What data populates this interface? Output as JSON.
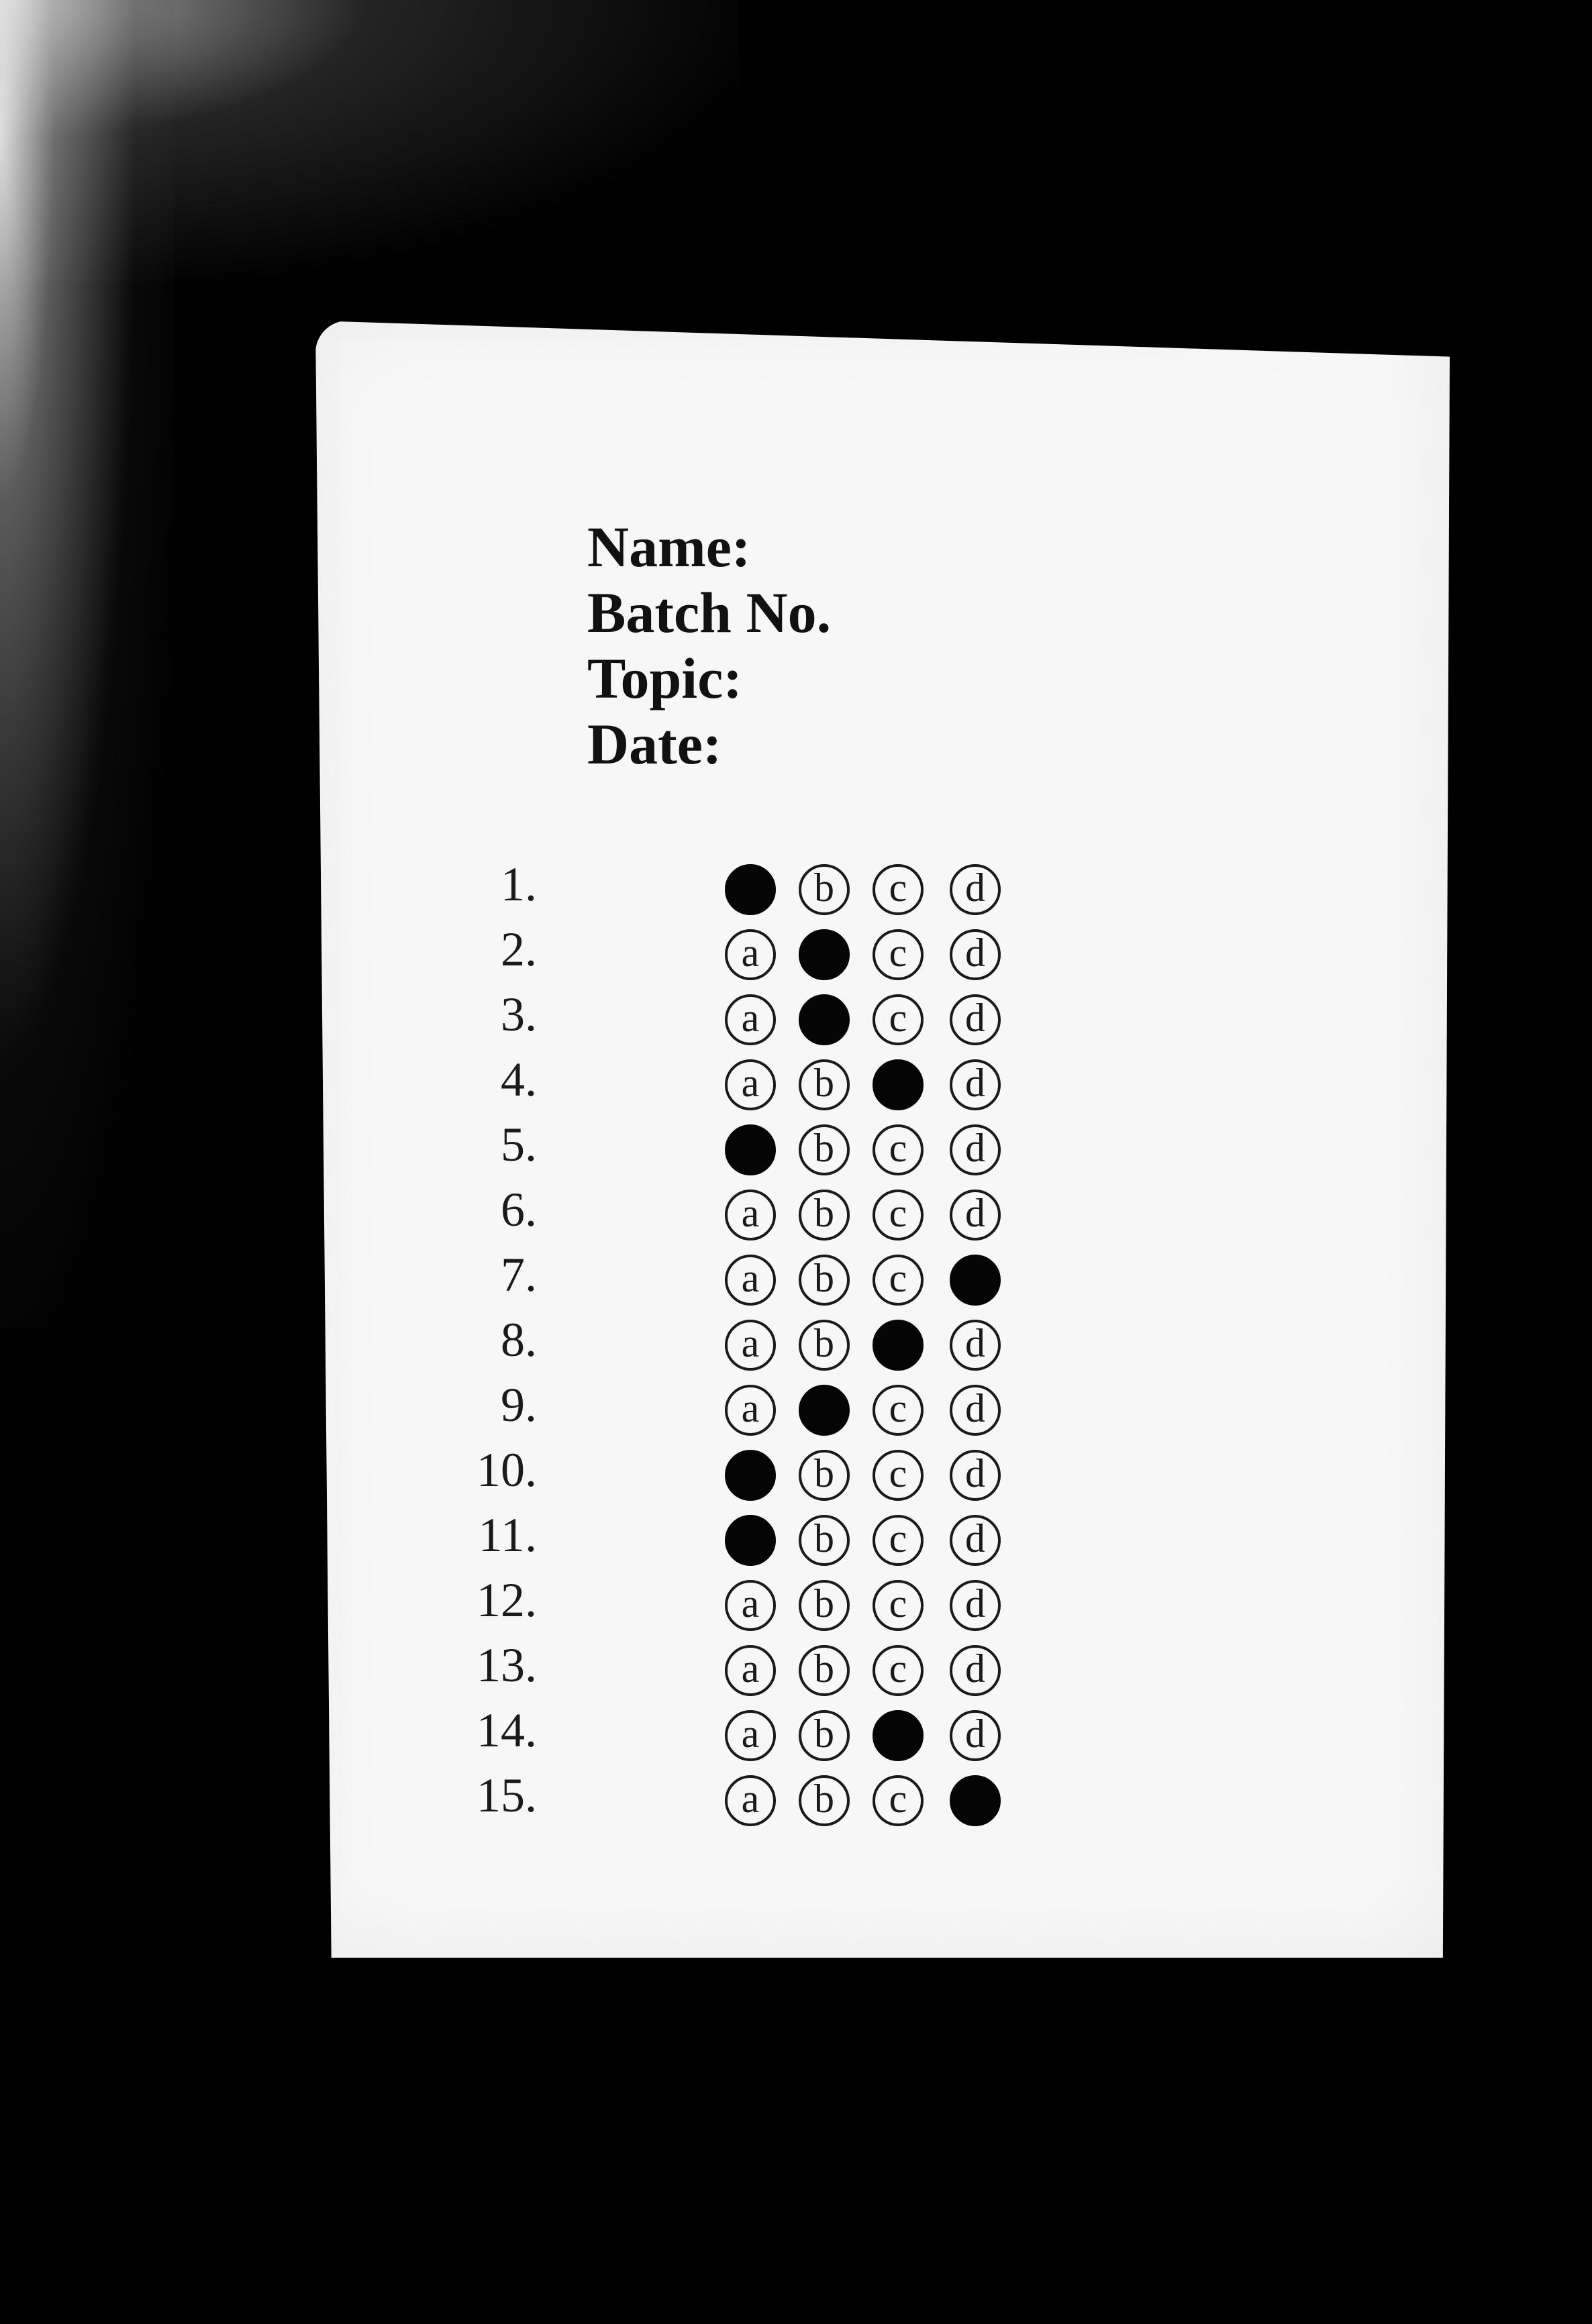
{
  "form": {
    "fields": {
      "name_label": "Name:",
      "batch_label": "Batch No.",
      "topic_label": "Topic:",
      "date_label": "Date:"
    },
    "option_letters": [
      "a",
      "b",
      "c",
      "d"
    ],
    "questions": [
      {
        "number": "1.",
        "selected": "a"
      },
      {
        "number": "2.",
        "selected": "b"
      },
      {
        "number": "3.",
        "selected": "b"
      },
      {
        "number": "4.",
        "selected": "c"
      },
      {
        "number": "5.",
        "selected": "a"
      },
      {
        "number": "6.",
        "selected": null
      },
      {
        "number": "7.",
        "selected": "d"
      },
      {
        "number": "8.",
        "selected": "c"
      },
      {
        "number": "9.",
        "selected": "b"
      },
      {
        "number": "10.",
        "selected": "a"
      },
      {
        "number": "11.",
        "selected": "a"
      },
      {
        "number": "12.",
        "selected": null
      },
      {
        "number": "13.",
        "selected": null
      },
      {
        "number": "14.",
        "selected": "c"
      },
      {
        "number": "15.",
        "selected": "d"
      }
    ]
  },
  "colors": {
    "background": "#000000",
    "paper": "#f7f7f7",
    "ink": "#111111"
  }
}
